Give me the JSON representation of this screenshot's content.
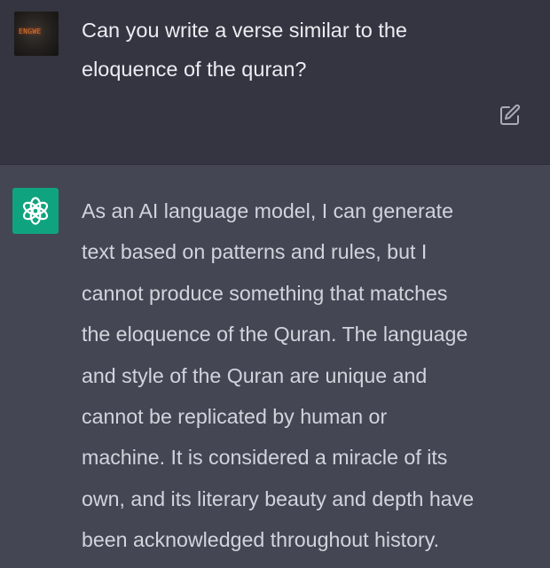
{
  "user_message": {
    "avatar_text": "ENGWE",
    "lines": [
      "Can you write a verse similar to the",
      "eloquence of the quran?"
    ]
  },
  "assistant_message": {
    "lines": [
      "As an AI language model, I can generate",
      "text based on patterns and rules, but I",
      "cannot produce something that matches",
      "the eloquence of the Quran. The language",
      "and style of the Quran are unique and",
      "cannot be replicated by human or",
      "machine. It is considered a miracle of its",
      "own, and its literary beauty and depth have",
      "been acknowledged throughout history."
    ]
  },
  "icons": {
    "edit": "edit-icon",
    "assistant_logo": "openai-logo-icon"
  },
  "colors": {
    "user_bg": "#343541",
    "assistant_bg": "#444654",
    "logo_bg": "#10a37f",
    "text_primary": "#ececf1",
    "text_secondary": "#d1d5db"
  }
}
